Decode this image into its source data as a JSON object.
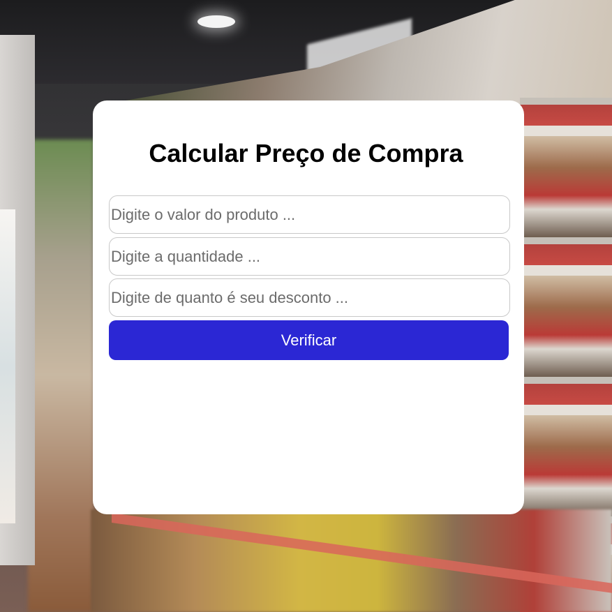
{
  "form": {
    "title": "Calcular Preço de Compra",
    "product_value_placeholder": "Digite o valor do produto ...",
    "quantity_placeholder": "Digite a quantidade ...",
    "discount_placeholder": "Digite de quanto é seu desconto ...",
    "submit_label": "Verificar"
  },
  "colors": {
    "card_background": "#ffffff",
    "button_background": "#2b27d4",
    "button_text": "#ffffff"
  }
}
